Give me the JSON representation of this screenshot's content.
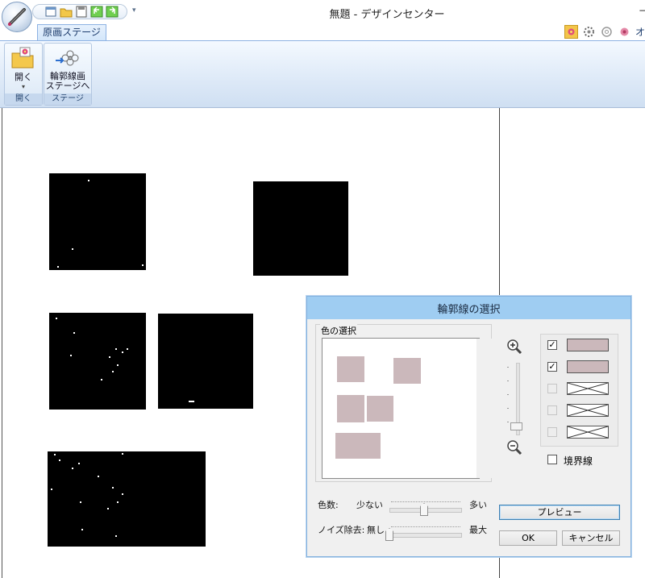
{
  "window": {
    "title": "無題 - デザインセンター"
  },
  "ribbon": {
    "tabs": [
      {
        "label": "原画ステージ"
      }
    ],
    "right_icons": [
      "flower-icon",
      "gear-flower-icon",
      "outline-flower-icon",
      "pink-flower-icon"
    ],
    "right_text": "オ",
    "groups": [
      {
        "caption": "開く",
        "button": {
          "label": "開く",
          "icon": "open-folder-icon"
        }
      },
      {
        "caption": "ステージ",
        "button": {
          "label_line1": "輪郭線画",
          "label_line2": "ステージへ",
          "icon": "outline-stage-icon"
        }
      }
    ]
  },
  "dialog": {
    "title": "輪郭線の選択",
    "color_group_label": "色の選択",
    "swatches": [
      {
        "checked": true,
        "enabled": true,
        "color": "#cbb8bb"
      },
      {
        "checked": true,
        "enabled": true,
        "color": "#cbb8bb"
      },
      {
        "checked": false,
        "enabled": false,
        "color": "none"
      },
      {
        "checked": false,
        "enabled": false,
        "color": "none"
      },
      {
        "checked": false,
        "enabled": false,
        "color": "none"
      }
    ],
    "border_checkbox": {
      "label": "境界線",
      "checked": false
    },
    "color_count": {
      "label": "色数:",
      "min_label": "少ない",
      "max_label": "多い",
      "level": 0.5
    },
    "noise_removal": {
      "label": "ノイズ除去:",
      "min_label": "無し",
      "max_label": "最大",
      "level": 0.0
    },
    "buttons": {
      "preview": "プレビュー",
      "ok": "OK",
      "cancel": "キャンセル"
    },
    "check_mark": "✓"
  },
  "colors": {
    "swatch_color": "#cbb8bb",
    "dialog_title_bar": "#9fcdf2",
    "ribbon_blue": "#dde9f7"
  }
}
